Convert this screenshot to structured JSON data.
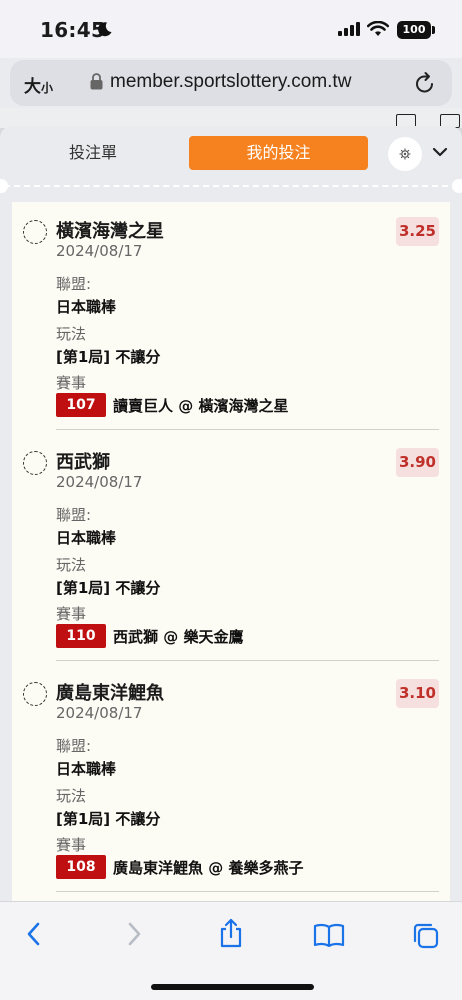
{
  "status_bar": {
    "time": "16:45",
    "battery": "100"
  },
  "url_bar": {
    "text_size_label_main": "大",
    "text_size_label_small": "小",
    "url": "member.sportslottery.com.tw"
  },
  "tabs": {
    "slip": "投注單",
    "my_bets": "我的投注"
  },
  "labels": {
    "league": "聯盟:",
    "market": "玩法",
    "event": "賽事"
  },
  "bets": [
    {
      "team": "橫濱海灣之星",
      "date": "2024/08/17",
      "odds": "3.25",
      "league": "日本職棒",
      "market": "[第1局] 不讓分",
      "game_number": "107",
      "matchup": "讀賣巨人 @ 橫濱海灣之星"
    },
    {
      "team": "西武獅",
      "date": "2024/08/17",
      "odds": "3.90",
      "league": "日本職棒",
      "market": "[第1局] 不讓分",
      "game_number": "110",
      "matchup": "西武獅 @ 樂天金鷹"
    },
    {
      "team": "廣島東洋鯉魚",
      "date": "2024/08/17",
      "odds": "3.10",
      "league": "日本職棒",
      "market": "[第1局] 不讓分",
      "game_number": "108",
      "matchup": "廣島東洋鯉魚 @ 養樂多燕子"
    }
  ],
  "colors": {
    "accent_orange": "#f5811f",
    "odds_red": "#c0302a",
    "game_badge_red": "#c00f10",
    "ios_blue": "#1a73e8"
  },
  "icons": {
    "moon": "moon-icon",
    "lock": "lock-icon",
    "reload": "reload-icon",
    "settings": "gear-icon",
    "collapse": "chevron-down-icon",
    "back": "chevron-left-icon",
    "forward": "chevron-right-icon",
    "share": "share-icon",
    "bookmarks": "book-icon",
    "tabs": "tabs-icon"
  }
}
